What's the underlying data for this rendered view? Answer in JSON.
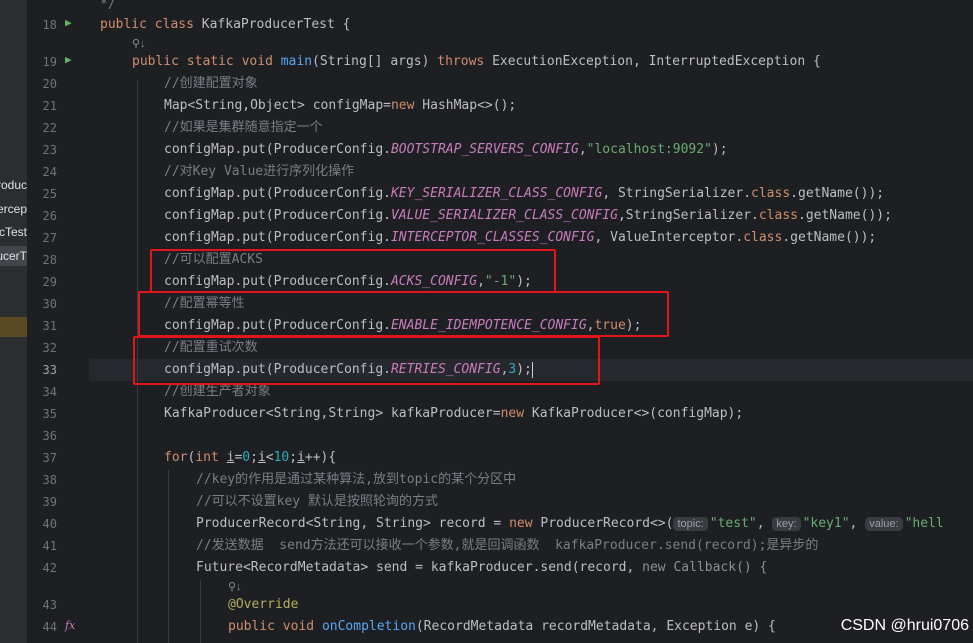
{
  "sidebar": {
    "items": [
      "roduc",
      "ercep",
      "cTest",
      "ucerT"
    ]
  },
  "gutter": {
    "line_numbers": [
      "18",
      "19",
      "20",
      "21",
      "22",
      "23",
      "24",
      "25",
      "26",
      "27",
      "28",
      "29",
      "30",
      "31",
      "32",
      "33",
      "34",
      "35",
      "36",
      "37",
      "38",
      "39",
      "40",
      "41",
      "42",
      "43",
      "44"
    ],
    "current_line": "33"
  },
  "code": {
    "l0_comment": "*/",
    "l18": {
      "kw1": "public",
      "kw2": "class",
      "name": "KafkaProducerTest",
      "rest": " {"
    },
    "lens_icon": "⚲↓",
    "l19": {
      "kw1": "public",
      "kw2": "static",
      "kw3": "void",
      "fn": "main",
      "args": "(String[] args) ",
      "kw4": "throws",
      "rest": " ExecutionException, InterruptedException {"
    },
    "l20": "//创建配置对象",
    "l21": {
      "a": "Map",
      "b": "<String,Object>",
      "c": " configMap=",
      "kw": "new",
      "d": " HashMap",
      "e": "<>",
      "f": "();"
    },
    "l22": "//如果是集群随意指定一个",
    "l23": {
      "a": "configMap.put(ProducerConfig.",
      "cn": "BOOTSTRAP_SERVERS_CONFIG",
      "b": ",",
      "st": "\"localhost:9092\"",
      "c": ");"
    },
    "l24": "//对Key Value进行序列化操作",
    "l25": {
      "a": "configMap.put(ProducerConfig.",
      "cn": "KEY_SERIALIZER_CLASS_CONFIG",
      "b": ", StringSerializer.",
      "kw": "class",
      "c": ".getName());"
    },
    "l26": {
      "a": "configMap.put(ProducerConfig.",
      "cn": "VALUE_SERIALIZER_CLASS_CONFIG",
      "b": ",StringSerializer.",
      "kw": "class",
      "c": ".getName());"
    },
    "l27": {
      "a": "configMap.put(ProducerConfig.",
      "cn": "INTERCEPTOR_CLASSES_CONFIG",
      "b": ", ValueInterceptor.",
      "kw": "class",
      "c": ".getName());"
    },
    "l28": "//可以配置ACKS",
    "l29": {
      "a": "configMap.put(ProducerConfig.",
      "cn": "ACKS_CONFIG",
      "b": ",",
      "st": "\"-1\"",
      "c": ");"
    },
    "l30": "//配置幂等性",
    "l31": {
      "a": "configMap.put(ProducerConfig.",
      "cn": "ENABLE_IDEMPOTENCE_CONFIG",
      "b": ",",
      "kw": "true",
      "c": ");"
    },
    "l32": "//配置重试次数",
    "l33": {
      "a": "configMap.put(ProducerConfig.",
      "cn": "RETRIES_CONFIG",
      "b": ",",
      "nm": "3",
      "c": ");"
    },
    "l34": "//创建生产者对象",
    "l35": {
      "a": "KafkaProducer",
      "b": "<String,String>",
      "c": " kafkaProducer=",
      "kw": "new",
      "d": " KafkaProducer",
      "e": "<>",
      "f": "(configMap);"
    },
    "l37": {
      "kw": "for",
      "a": "(",
      "kw2": "int",
      "v1": "i",
      "b": "=",
      "n1": "0",
      "c": ";",
      "v2": "i",
      "d": "<",
      "n2": "10",
      "e": ";",
      "v3": "i",
      "f": "++){"
    },
    "l38": "//key的作用是通过某种算法,放到topic的某个分区中",
    "l39": "//可以不设置key 默认是按照轮询的方式",
    "l40": {
      "a": "ProducerRecord",
      "b": "<String, String>",
      "c": " record = ",
      "kw": "new",
      "d": " ProducerRecord",
      "e": "<>",
      "f": "(",
      "h1": "topic:",
      "s1": "\"test\"",
      "g": ", ",
      "h2": "key:",
      "s2": "\"key1\"",
      "g2": ", ",
      "h3": "value:",
      "s3": "\"hell"
    },
    "l41": "//发送数据  send方法还可以接收一个参数,就是回调函数  kafkaProducer.send(record);是异步的",
    "l42": {
      "a": "Future",
      "b": "<RecordMetadata>",
      "c": " send = kafkaProducer.send(record, ",
      "kw": "new",
      "d": " Callback() {"
    },
    "l43": "@Override",
    "l44": {
      "kw1": "public",
      "kw2": "void",
      "fn": "onCompletion",
      "rest": "(RecordMetadata recordMetadata, Exception e) {"
    }
  },
  "watermark": "CSDN @hrui0706",
  "colors": {
    "highlight_box": "#e0161b",
    "background": "#1e1f22",
    "keyword": "#cf8e6d",
    "constant": "#c77dbb",
    "string": "#6aab73",
    "comment": "#7a7e85"
  }
}
